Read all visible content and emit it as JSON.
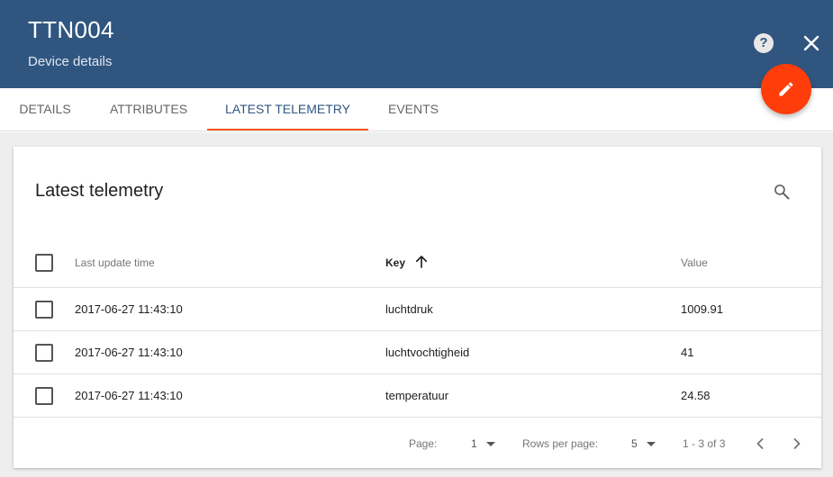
{
  "header": {
    "title": "TTN004",
    "subtitle": "Device details",
    "help_label": "?"
  },
  "tabs": [
    {
      "label": "DETAILS",
      "active": false
    },
    {
      "label": "ATTRIBUTES",
      "active": false
    },
    {
      "label": "LATEST TELEMETRY",
      "active": true
    },
    {
      "label": "EVENTS",
      "active": false
    }
  ],
  "card": {
    "title": "Latest telemetry"
  },
  "table": {
    "columns": [
      "Last update time",
      "Key",
      "Value"
    ],
    "sorted_column": "Key",
    "sort_direction": "ascending",
    "rows": [
      {
        "time": "2017-06-27 11:43:10",
        "key": "luchtdruk",
        "value": "1009.91",
        "checked": false
      },
      {
        "time": "2017-06-27 11:43:10",
        "key": "luchtvochtigheid",
        "value": "41",
        "checked": false
      },
      {
        "time": "2017-06-27 11:43:10",
        "key": "temperatuur",
        "value": "24.58",
        "checked": false
      }
    ]
  },
  "pagination": {
    "page_label": "Page:",
    "page_value": "1",
    "rows_label": "Rows per page:",
    "rows_value": "5",
    "range_text": "1 - 3 of 3"
  },
  "colors": {
    "header_bg": "#305680",
    "accent": "#ff5722",
    "fab": "#ff3d0a"
  },
  "icons": {
    "help": "help-circle-icon",
    "close": "close-icon",
    "edit": "pencil-icon",
    "search": "search-icon",
    "sort": "arrow-up-icon",
    "prev": "chevron-left-icon",
    "next": "chevron-right-icon"
  }
}
